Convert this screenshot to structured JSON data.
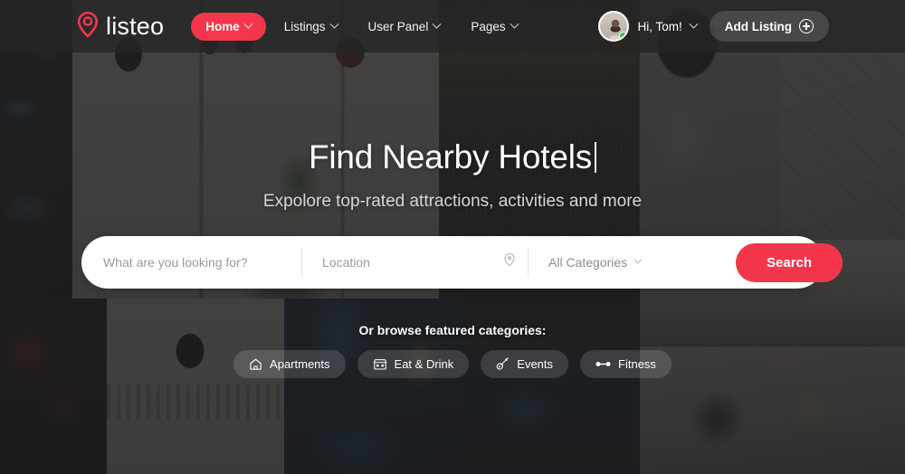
{
  "brand": {
    "name": "listeo",
    "accent_color": "#f4364c",
    "logo_icon": "map-pin-icon"
  },
  "header": {
    "nav": [
      {
        "label": "Home",
        "icon": "chevron-down-icon",
        "active": true
      },
      {
        "label": "Listings",
        "icon": "chevron-down-icon",
        "active": false
      },
      {
        "label": "User Panel",
        "icon": "chevron-down-icon",
        "active": false
      },
      {
        "label": "Pages",
        "icon": "chevron-down-icon",
        "active": false
      }
    ],
    "user": {
      "greeting": "Hi, Tom!",
      "avatar_icon": "user-avatar",
      "status": "online",
      "status_color": "#2bc14a"
    },
    "add_listing": {
      "label": "Add Listing",
      "icon": "plus-circle-icon"
    }
  },
  "hero": {
    "title": "Find Nearby Hotels",
    "subtitle": "Expolore top-rated attractions, activities and more"
  },
  "search": {
    "keyword_placeholder": "What are you looking for?",
    "keyword_value": "",
    "location_placeholder": "Location",
    "location_value": "",
    "location_icon": "map-pin-icon",
    "category_selected": "All Categories",
    "category_icon": "chevron-down-icon",
    "button_label": "Search"
  },
  "featured": {
    "label": "Or browse featured categories:",
    "categories": [
      {
        "label": "Apartments",
        "icon": "home-icon"
      },
      {
        "label": "Eat & Drink",
        "icon": "storefront-icon"
      },
      {
        "label": "Events",
        "icon": "guitar-icon"
      },
      {
        "label": "Fitness",
        "icon": "dumbbell-icon"
      }
    ]
  }
}
